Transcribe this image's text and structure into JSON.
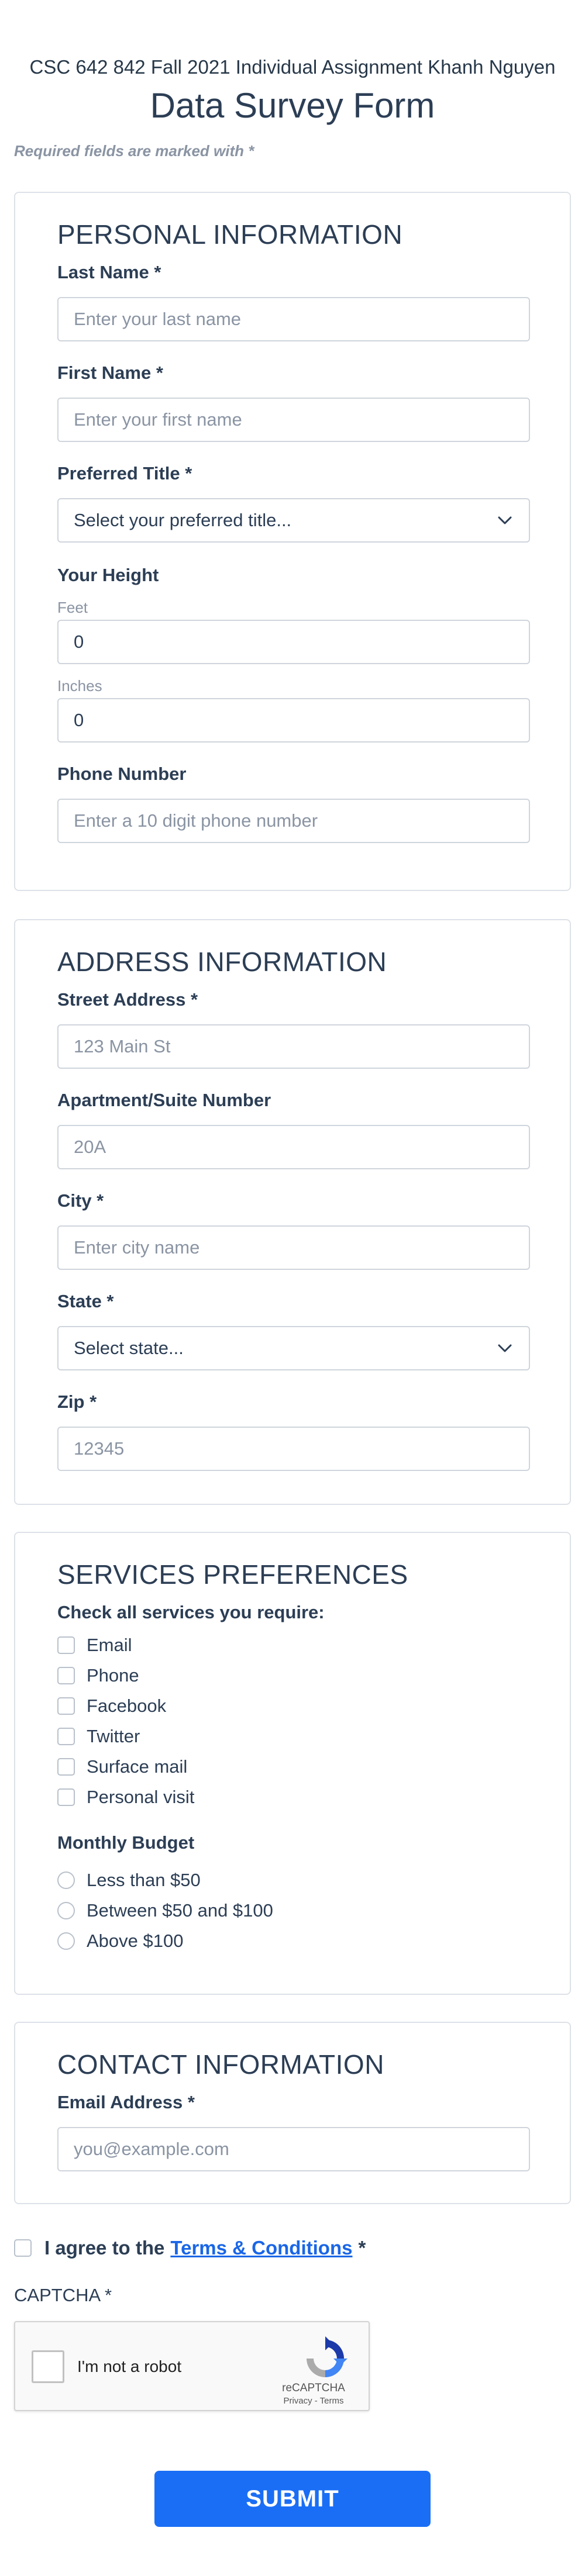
{
  "header": {
    "course_line": "CSC 642 842 Fall 2021 Individual Assignment Khanh Nguyen",
    "title": "Data Survey Form",
    "required_note": "Required fields are marked with *"
  },
  "personal": {
    "title": "PERSONAL INFORMATION",
    "last_name_label": "Last Name *",
    "last_name_placeholder": "Enter your last name",
    "first_name_label": "First Name *",
    "first_name_placeholder": "Enter your first name",
    "title_label": "Preferred Title *",
    "title_select": "Select your preferred title...",
    "height_label": "Your Height",
    "feet_label": "Feet",
    "feet_value": "0",
    "inches_label": "Inches",
    "inches_value": "0",
    "phone_label": "Phone Number",
    "phone_placeholder": "Enter a 10 digit phone number"
  },
  "address": {
    "title": "ADDRESS INFORMATION",
    "street_label": "Street Address *",
    "street_placeholder": "123 Main St",
    "apt_label": "Apartment/Suite Number",
    "apt_placeholder": "20A",
    "city_label": "City *",
    "city_placeholder": "Enter city name",
    "state_label": "State *",
    "state_select": "Select state...",
    "zip_label": "Zip *",
    "zip_placeholder": "12345"
  },
  "services": {
    "title": "SERVICES PREFERENCES",
    "check_label": "Check all services you require:",
    "options": [
      "Email",
      "Phone",
      "Facebook",
      "Twitter",
      "Surface mail",
      "Personal visit"
    ],
    "budget_label": "Monthly Budget",
    "budget_options": [
      "Less than $50",
      "Between $50 and $100",
      "Above $100"
    ]
  },
  "contact": {
    "title": "CONTACT INFORMATION",
    "email_label": "Email Address *",
    "email_placeholder": "you@example.com"
  },
  "agreement": {
    "prefix": "I agree to the",
    "link": "Terms & Conditions",
    "suffix": "*",
    "link_color": "#1a66e6"
  },
  "captcha": {
    "label": "CAPTCHA *",
    "checkbox_text": "I'm not a robot",
    "brand": "reCAPTCHA",
    "links": "Privacy - Terms"
  },
  "submit_label": "SUBMIT",
  "colors": {
    "accent": "#1a6ef5",
    "text": "#2c3e55",
    "muted": "#8a94a3",
    "border": "#cfd5dc"
  }
}
